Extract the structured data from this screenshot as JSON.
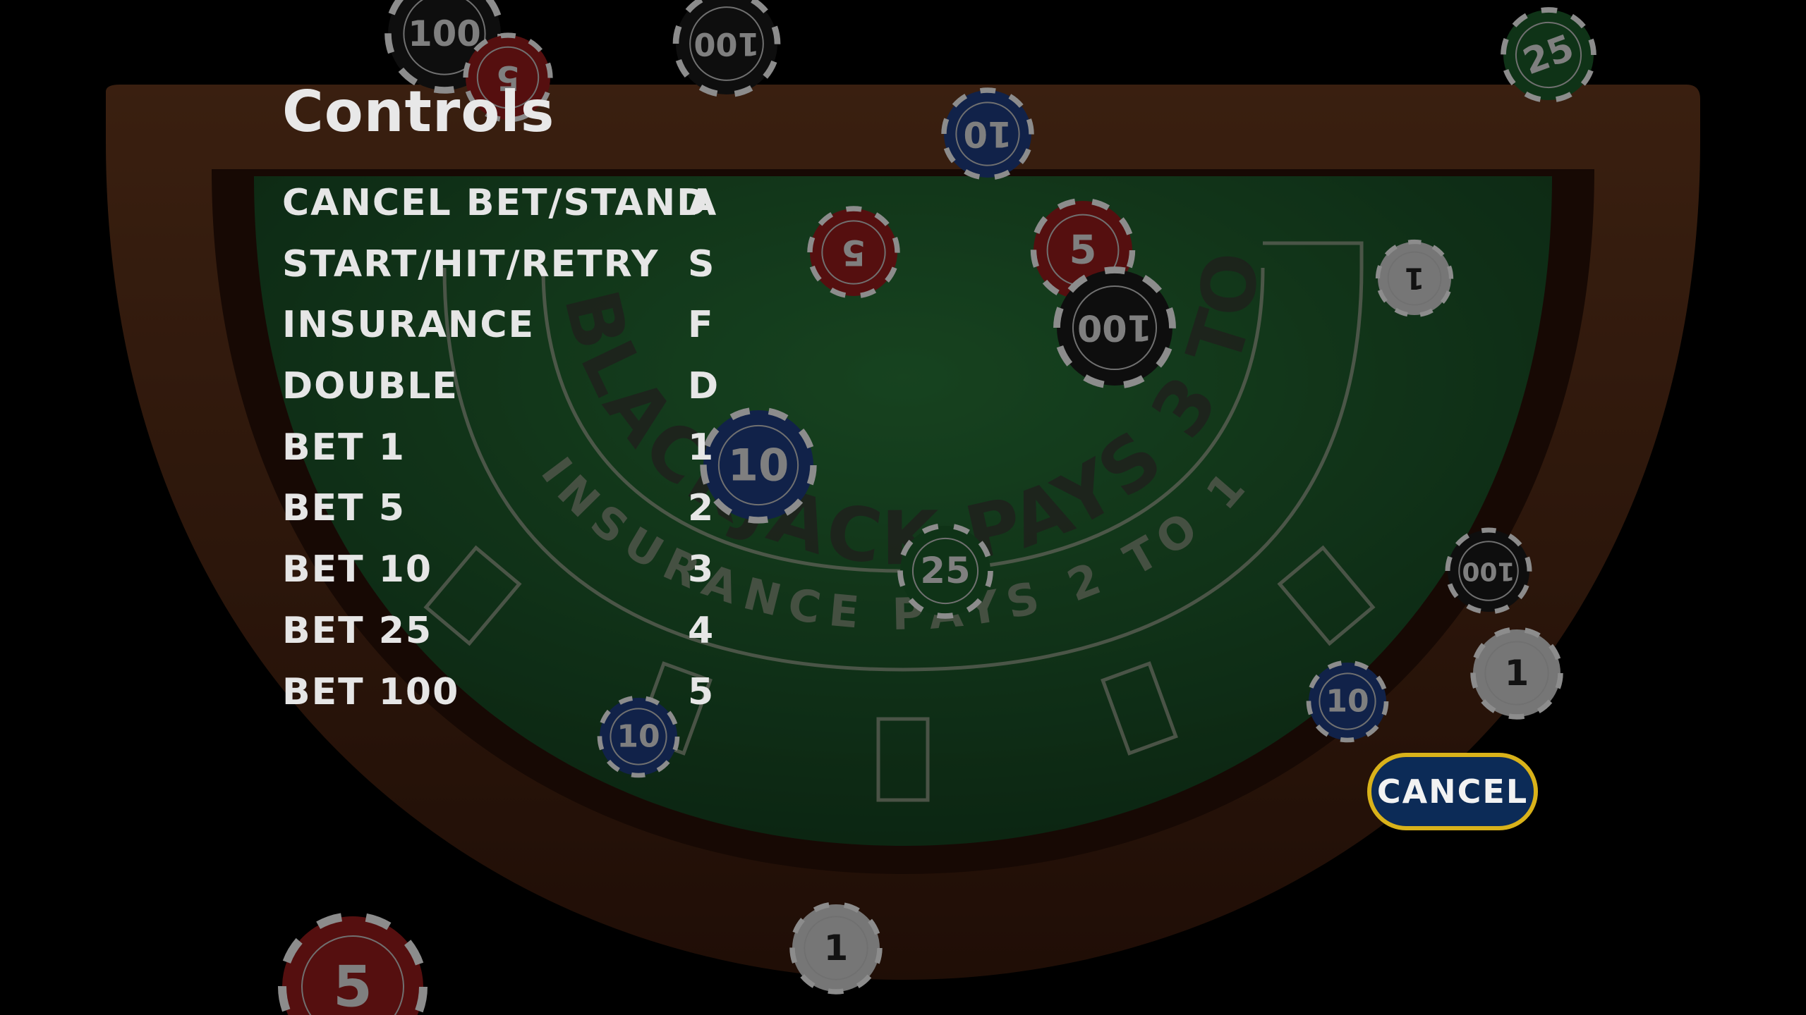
{
  "dialog": {
    "title": "Controls"
  },
  "controls": [
    {
      "action": "CANCEL BET/STAND",
      "key": "A"
    },
    {
      "action": "START/HIT/RETRY",
      "key": "S"
    },
    {
      "action": "INSURANCE",
      "key": "F"
    },
    {
      "action": "DOUBLE",
      "key": "D"
    },
    {
      "action": "BET 1",
      "key": "1"
    },
    {
      "action": "BET 5",
      "key": "2"
    },
    {
      "action": "BET 10",
      "key": "3"
    },
    {
      "action": "BET 25",
      "key": "4"
    },
    {
      "action": "BET 100",
      "key": "5"
    }
  ],
  "cancel_button": {
    "label": "CANCEL"
  },
  "table": {
    "arc_text_outer": "BLACKJACK PAYS 3 TO 1",
    "arc_text_inner": "INSURANCE PAYS 2 TO 1"
  },
  "chips": [
    {
      "value": "100",
      "color": "#1a1a1a"
    },
    {
      "value": "100",
      "color": "#1a1a1a"
    },
    {
      "value": "25",
      "color": "#1d5e2a"
    },
    {
      "value": "10",
      "color": "#1f3f86"
    },
    {
      "value": "5",
      "color": "#9c1c1c"
    },
    {
      "value": "5",
      "color": "#9c1c1c"
    },
    {
      "value": "100",
      "color": "#1a1a1a"
    },
    {
      "value": "1",
      "color": "#d8d8d8"
    },
    {
      "value": "10",
      "color": "#1f3f86"
    },
    {
      "value": "25",
      "color": "#1d5e2a"
    },
    {
      "value": "10",
      "color": "#1f3f86"
    },
    {
      "value": "10",
      "color": "#1f3f86"
    },
    {
      "value": "1",
      "color": "#d8d8d8"
    },
    {
      "value": "1",
      "color": "#d8d8d8"
    },
    {
      "value": "5",
      "color": "#9c1c1c"
    },
    {
      "value": "5",
      "color": "#9c1c1c"
    },
    {
      "value": "100",
      "color": "#1a1a1a"
    }
  ],
  "colors": {
    "felt": "#1f5a2c",
    "rail": "#4a2412",
    "button_fill": "#0c2b57",
    "button_border": "#d9b21a",
    "text": "#e6e6e6"
  }
}
